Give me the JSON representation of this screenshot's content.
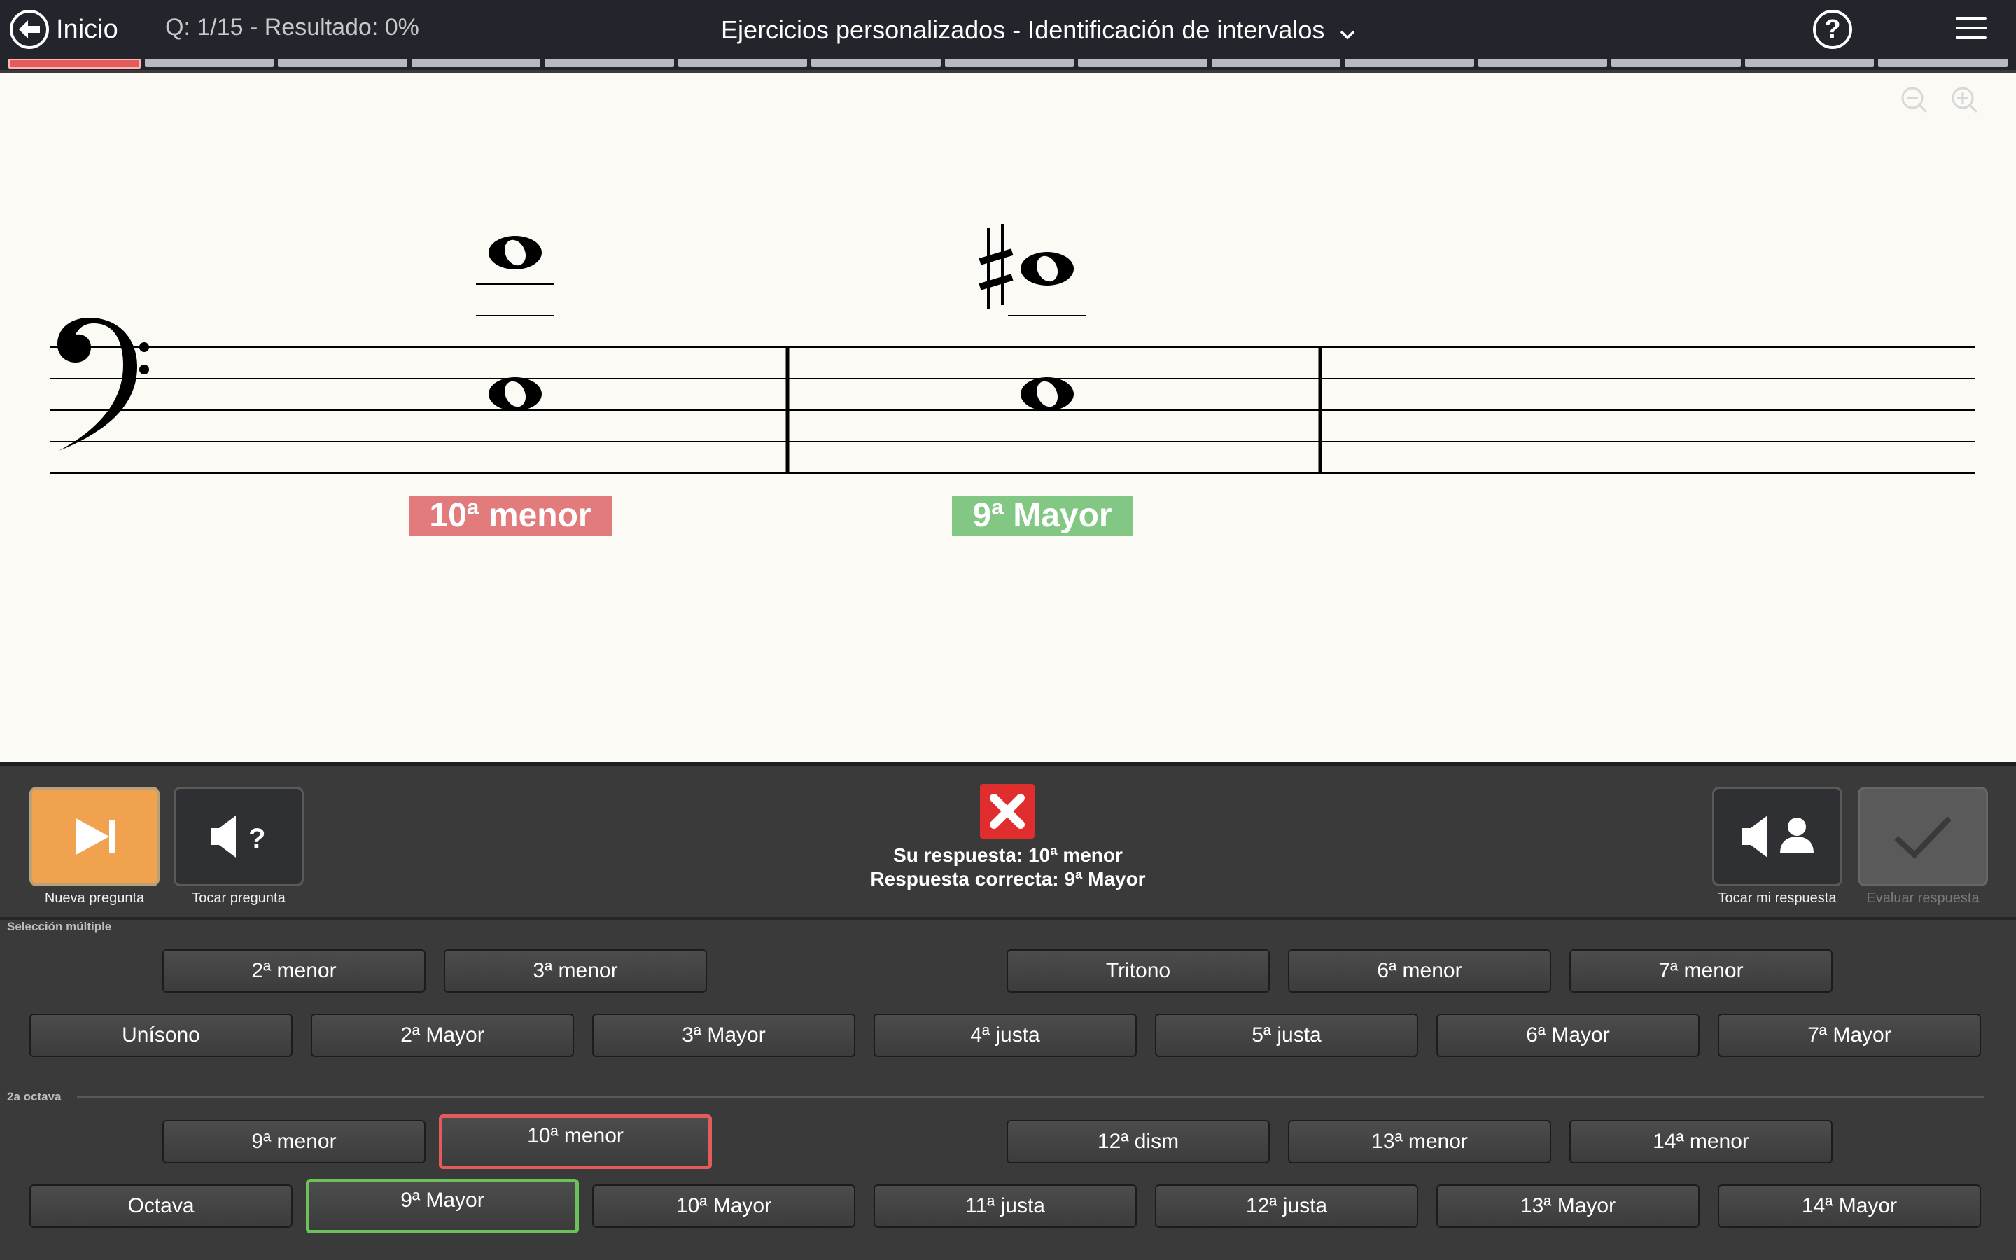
{
  "topbar": {
    "home_label": "Inicio",
    "progress_text": "Q: 1/15 - Resultado: 0%",
    "title": "Ejercicios personalizados - Identificación de intervalos",
    "help_glyph": "?",
    "segments": 15,
    "current_segment": 1
  },
  "score": {
    "clef": "bass-clef",
    "measures": [
      {
        "interval_label": "10ª menor",
        "label_color": "#e27b7b",
        "accidental": ""
      },
      {
        "interval_label": "9ª Mayor",
        "label_color": "#82c784",
        "accidental": "sharp"
      }
    ]
  },
  "controls": {
    "new_question": "Nueva pregunta",
    "play_question": "Tocar pregunta",
    "play_question_glyph": "?",
    "play_mine": "Tocar mi respuesta",
    "evaluate": "Evaluar respuesta"
  },
  "feedback": {
    "status": "incorrect",
    "your_answer": "Su respuesta: 10ª menor",
    "correct_answer": "Respuesta correcta: 9ª Mayor"
  },
  "answers": {
    "section1_label": "Selección múltiple",
    "section2_label": "2a octava",
    "row1": [
      "2ª menor",
      "3ª menor",
      "Tritono",
      "6ª menor",
      "7ª menor"
    ],
    "row2": [
      "Unísono",
      "2ª Mayor",
      "3ª Mayor",
      "4ª justa",
      "5ª justa",
      "6ª Mayor",
      "7ª Mayor"
    ],
    "row3": [
      "9ª menor",
      "10ª menor",
      "12ª dism",
      "13ª menor",
      "14ª menor"
    ],
    "row4": [
      "Octava",
      "9ª Mayor",
      "10ª Mayor",
      "11ª justa",
      "12ª justa",
      "13ª Mayor",
      "14ª Mayor"
    ],
    "selected": "10ª menor",
    "correct": "9ª Mayor"
  },
  "colors": {
    "topbar": "#23252d",
    "wrong": "#e35c5c",
    "right": "#6cc15b",
    "accent_orange": "#f0a24e"
  }
}
